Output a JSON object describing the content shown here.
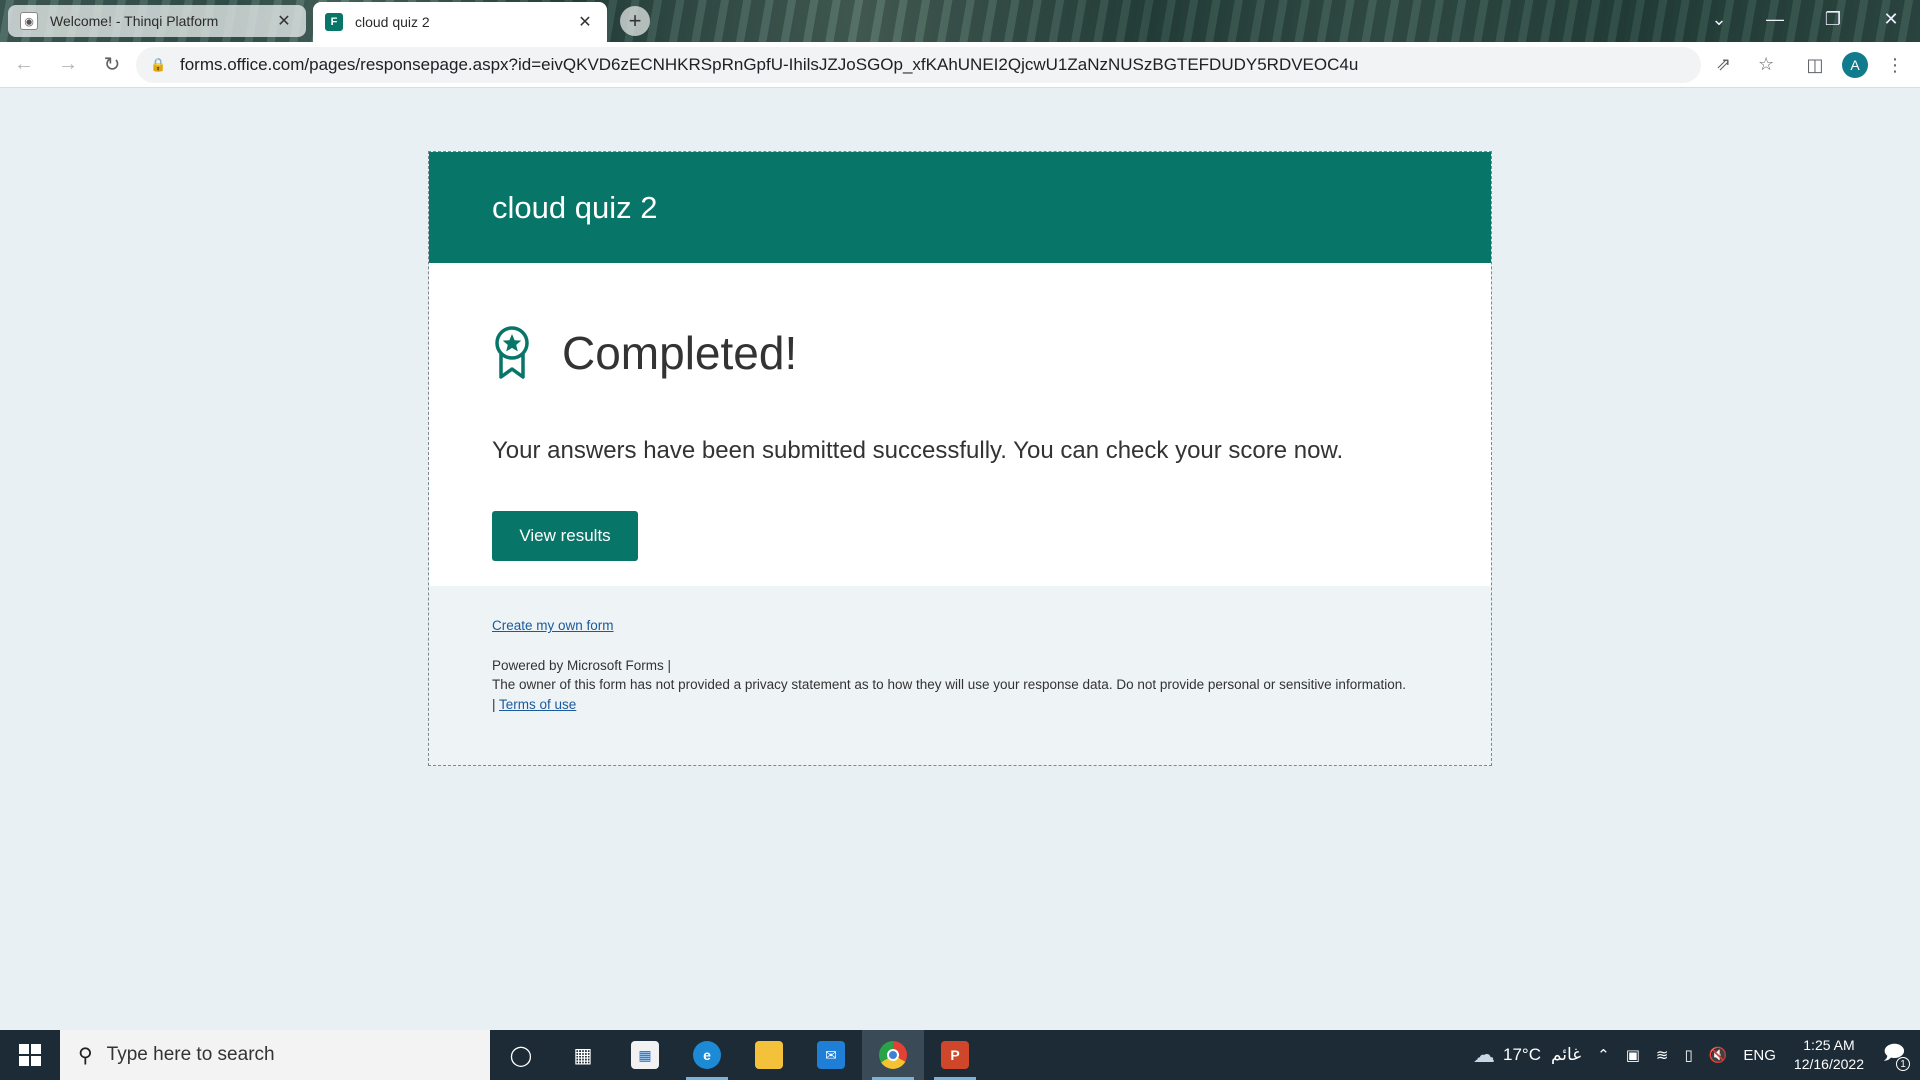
{
  "browser": {
    "tabs": [
      {
        "title": "Welcome! - Thinqi Platform",
        "active": false
      },
      {
        "title": "cloud quiz 2",
        "active": true
      }
    ],
    "url": "forms.office.com/pages/responsepage.aspx?id=eivQKVD6zECNHKRSpRnGpfU-IhilsJZJoSGOp_xfKAhUNEI2QjcwU1ZaNzNUSzBGTEFDUDY5RDVEOC4u",
    "profile_initial": "A"
  },
  "form": {
    "title": "cloud quiz 2",
    "completed_heading": "Completed!",
    "message": "Your answers have been submitted successfully. You can check your score now.",
    "view_results_label": "View results",
    "footer": {
      "create_link": "Create my own form",
      "powered_by": "Powered by Microsoft Forms |",
      "privacy_text": "The owner of this form has not provided a privacy statement as to how they will use your response data. Do not provide personal or sensitive information.",
      "separator": "|",
      "terms_link": "Terms of use"
    }
  },
  "taskbar": {
    "search_placeholder": "Type here to search",
    "weather_temp": "17°C",
    "weather_desc": "غائم",
    "language": "ENG",
    "time": "1:25 AM",
    "date": "12/16/2022",
    "notification_count": "1"
  },
  "colors": {
    "brand_teal": "#077568",
    "page_bg": "#e9f0f3",
    "link": "#1a5a9c"
  }
}
